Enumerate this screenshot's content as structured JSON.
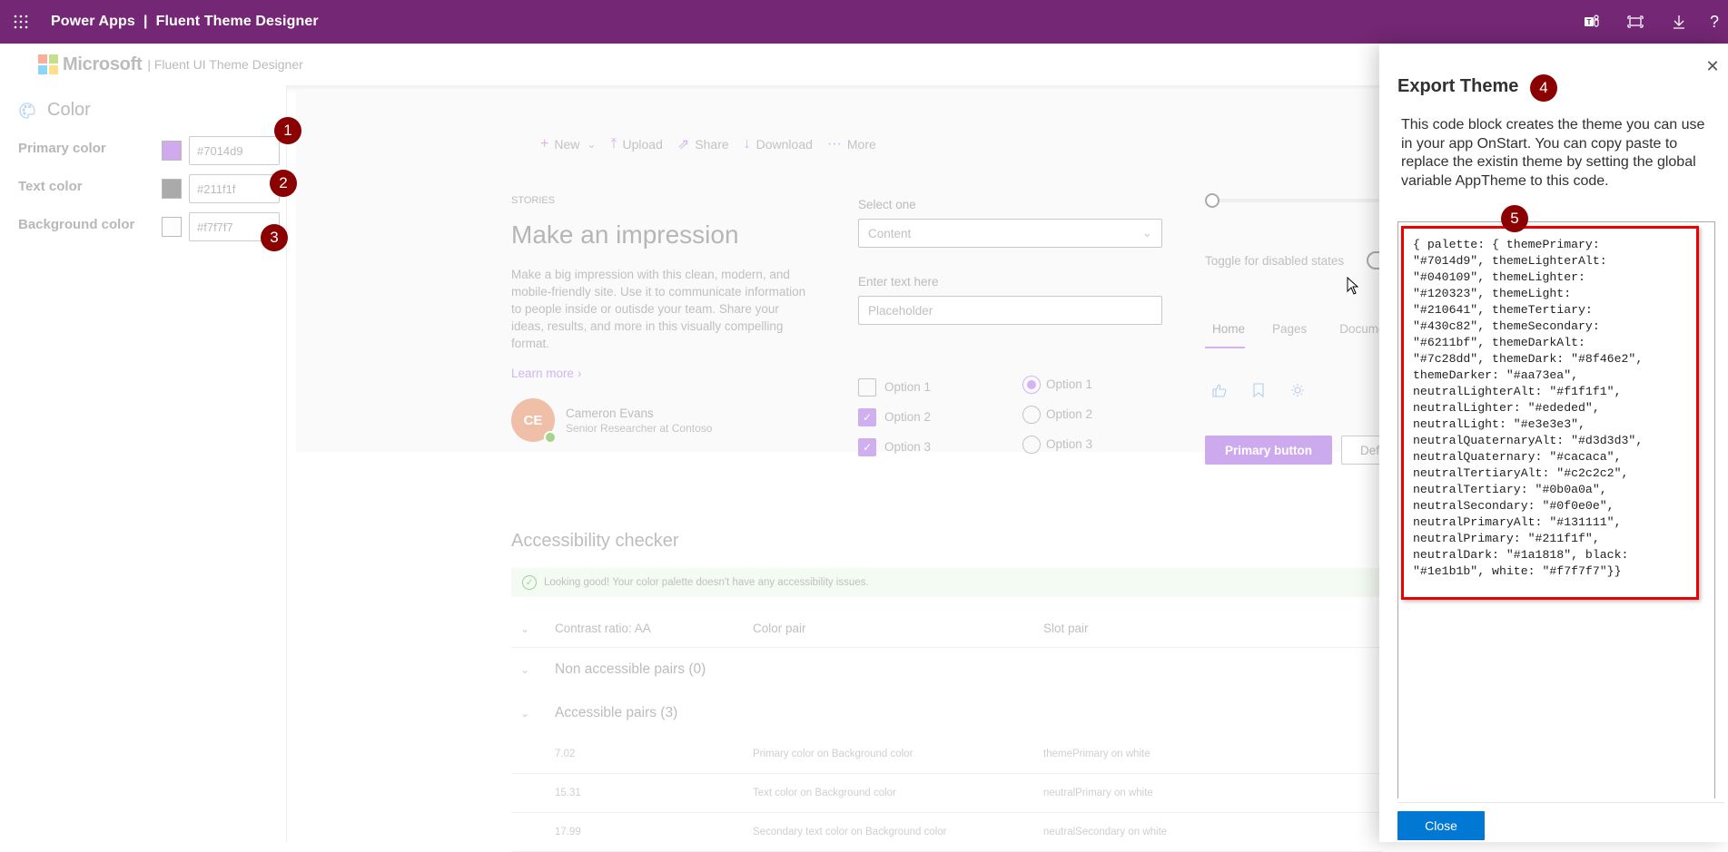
{
  "topbar": {
    "title": "Power Apps  |  Fluent Theme Designer",
    "icons": [
      "waffle-icon",
      "teams-icon",
      "fit-screen-icon",
      "download-icon",
      "help-icon"
    ],
    "help_glyph": "?",
    "bg_color": "#742774"
  },
  "app_header": {
    "brand": "Microsoft",
    "subtitle": "| Fluent UI Theme Designer"
  },
  "left_pane": {
    "section_title": "Color",
    "rows": [
      {
        "label": "Primary color",
        "value": "#7014d9",
        "swatch": "#cfaaee",
        "badge": "1"
      },
      {
        "label": "Text color",
        "value": "#211f1f",
        "swatch": "#aaaaaa",
        "badge": "2"
      },
      {
        "label": "Background color",
        "value": "#f7f7f7",
        "swatch": "#fdfdfd",
        "badge": "3"
      }
    ]
  },
  "commandbar": {
    "items": [
      {
        "icon": "+",
        "label": "New",
        "chevron": "⌄"
      },
      {
        "icon": "⤒",
        "label": "Upload"
      },
      {
        "icon": "⇗",
        "label": "Share"
      },
      {
        "icon": "↓",
        "label": "Download"
      },
      {
        "icon": "···",
        "label": "More"
      }
    ]
  },
  "stories": {
    "eyebrow": "STORIES",
    "title": "Make an impression",
    "body": "Make a big impression with this clean, modern, and mobile-friendly site. Use it to communicate information to people inside or outisde your team. Share your ideas, results, and more in this visually compelling format.",
    "learn_more": "Learn more",
    "learn_more_chevron": "›",
    "persona": {
      "initials": "CE",
      "name": "Cameron Evans",
      "role": "Senior Researcher at Contoso"
    }
  },
  "forms": {
    "select_label": "Select one",
    "select_value": "Content",
    "select_chevron": "⌄",
    "text_label": "Enter text here",
    "text_placeholder": "Placeholder",
    "checkboxes": [
      {
        "label": "Option 1",
        "checked": false
      },
      {
        "label": "Option 2",
        "checked": true
      },
      {
        "label": "Option 3",
        "checked": true
      }
    ],
    "check_glyph": "✓",
    "radios": [
      {
        "label": "Option 1",
        "selected": true
      },
      {
        "label": "Option 2",
        "selected": false
      },
      {
        "label": "Option 3",
        "selected": false
      }
    ]
  },
  "right_demo": {
    "slider_value": 0,
    "toggle_label": "Toggle for disabled states",
    "pivot": [
      "Home",
      "Pages",
      "Documents"
    ],
    "pivot_selected": "Home",
    "icons": [
      {
        "name": "like-icon",
        "glyph": "👍"
      },
      {
        "name": "bookmark-icon",
        "glyph": "🔖"
      },
      {
        "name": "sun-icon",
        "glyph": "☼"
      }
    ],
    "primary_button": "Primary button",
    "default_button": "Default"
  },
  "accessibility": {
    "title": "Accessibility checker",
    "status": "Looking good! Your color palette doesn't have any accessibility issues.",
    "status_glyph": "✓",
    "columns": [
      "Contrast ratio: AA",
      "Color pair",
      "Slot pair"
    ],
    "chevron": "⌄",
    "groups": [
      {
        "label": "Non accessible pairs (0)"
      },
      {
        "label": "Accessible pairs (3)"
      }
    ],
    "rows": [
      {
        "ratio": "7.02",
        "color_pair": "Primary color on Background color",
        "slot_pair": "themePrimary on white"
      },
      {
        "ratio": "15.31",
        "color_pair": "Text color on Background color",
        "slot_pair": "neutralPrimary on white"
      },
      {
        "ratio": "17.99",
        "color_pair": "Secondary text color on Background color",
        "slot_pair": "neutralSecondary on white"
      }
    ]
  },
  "export_panel": {
    "title": "Export Theme",
    "title_badge": "4",
    "code_badge": "5",
    "close_glyph": "✕",
    "description": "This code block creates the theme you can use in your app OnStart. You can copy paste to replace the existin theme by setting the global variable AppTheme to this code.",
    "code": "{ palette: { themePrimary:\n\"#7014d9\", themeLighterAlt:\n\"#040109\", themeLighter:\n\"#120323\", themeLight:\n\"#210641\", themeTertiary:\n\"#430c82\", themeSecondary:\n\"#6211bf\", themeDarkAlt:\n\"#7c28dd\", themeDark: \"#8f46e2\",\nthemeDarker: \"#aa73ea\",\nneutralLighterAlt: \"#f1f1f1\",\nneutralLighter: \"#ededed\",\nneutralLight: \"#e3e3e3\",\nneutralQuaternaryAlt: \"#d3d3d3\",\nneutralQuaternary: \"#cacaca\",\nneutralTertiaryAlt: \"#c2c2c2\",\nneutralTertiary: \"#0b0a0a\",\nneutralSecondary: \"#0f0e0e\",\nneutralPrimaryAlt: \"#131111\",\nneutralPrimary: \"#211f1f\",\nneutralDark: \"#1a1818\", black:\n\"#1e1b1b\", white: \"#f7f7f7\"}}",
    "close_button": "Close",
    "close_button_color": "#0078d4"
  }
}
